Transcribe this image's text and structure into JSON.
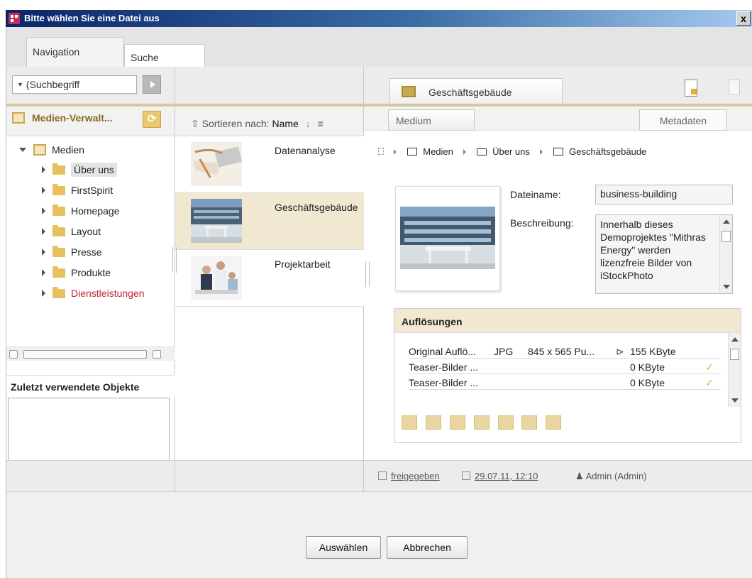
{
  "window": {
    "title": "Bitte wählen Sie eine Datei aus",
    "close_label": "x"
  },
  "tabs": [
    {
      "label": "Navigation"
    },
    {
      "label": "Suche"
    }
  ],
  "left": {
    "search_placeholder": "(Suchbegriff",
    "media_header": "Medien-Verwalt...",
    "tree": [
      {
        "label": "Medien"
      },
      {
        "label": "Über uns"
      },
      {
        "label": "FirstSpirit"
      },
      {
        "label": "Homepage"
      },
      {
        "label": "Layout"
      },
      {
        "label": "Presse"
      },
      {
        "label": "Produkte"
      },
      {
        "label": "Dienstleistungen"
      }
    ],
    "recent_header": "Zuletzt verwendete Objekte"
  },
  "middle": {
    "sort_label": "Sortieren nach:",
    "sort_value": "Name",
    "items": [
      {
        "name": "Datenanalyse"
      },
      {
        "name": "Geschäftsgebäude"
      },
      {
        "name": "Projektarbeit"
      }
    ]
  },
  "right": {
    "file_tab": "Geschäftsgebäude",
    "subtabs": {
      "medium": "Medium",
      "metadata": "Metadaten"
    },
    "breadcrumb": [
      "Medien",
      "Über uns",
      "Geschäftsgebäude"
    ],
    "filename_label": "Dateiname:",
    "filename_value": "business-building",
    "description_label": "Beschreibung:",
    "description_value": "Innerhalb dieses Demoprojektes \"Mithras Energy\" werden lizenzfreie Bilder von iStockPhoto",
    "resolutions_header": "Auflösungen",
    "resolutions": [
      {
        "name": "Original Auflö...",
        "format": "JPG",
        "size_px": "845 x 565 Pu...",
        "size": "155 KByte",
        "check": ""
      },
      {
        "name": "Teaser-Bilder ...",
        "format": "",
        "size_px": "",
        "size": "0 KByte",
        "check": "✓"
      },
      {
        "name": "Teaser-Bilder ...",
        "format": "",
        "size_px": "",
        "size": "0 KByte",
        "check": "✓"
      }
    ],
    "status": {
      "state": "freigegeben",
      "date": "29.07.11, 12:10",
      "user": "Admin (Admin)"
    }
  },
  "buttons": {
    "select": "Auswählen",
    "cancel": "Abbrechen"
  },
  "colors": {
    "accent_gold": "#d8c79a",
    "selected_row": "#f1e8d2",
    "link_red": "#c0253a"
  }
}
